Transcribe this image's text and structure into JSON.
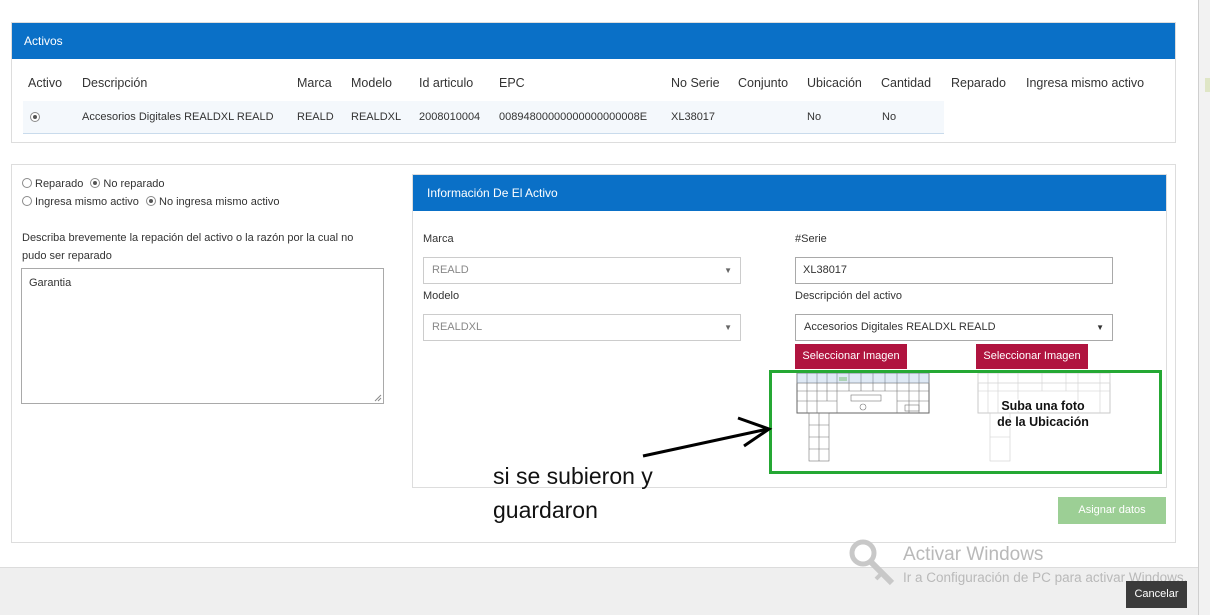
{
  "activos_panel": {
    "title": "Activos",
    "columns": [
      "Activo",
      "Descripción",
      "Marca",
      "Modelo",
      "Id articulo",
      "EPC",
      "No Serie",
      "Conjunto",
      "Ubicación",
      "Cantidad",
      "Reparado",
      "Ingresa mismo activo"
    ],
    "row": {
      "descripcion": "Accesorios Digitales REALDXL REALD",
      "marca": "REALD",
      "modelo": "REALDXL",
      "id_articulo": "2008010004",
      "epc": "00894800000000000000008E",
      "no_serie": "XL38017",
      "conjunto": "",
      "ubicacion": "No",
      "cantidad": "No"
    }
  },
  "repair_form": {
    "reparado_label": "Reparado",
    "no_reparado_label": "No reparado",
    "ingresa_label": "Ingresa mismo activo",
    "no_ingresa_label": "No ingresa mismo activo",
    "reason_label": "Describa brevemente la repación del activo o la razón por la cual no pudo ser reparado",
    "reason_value": "Garantia"
  },
  "info_panel": {
    "title": "Información De El Activo",
    "marca_label": "Marca",
    "marca_value": "REALD",
    "modelo_label": "Modelo",
    "modelo_value": "REALDXL",
    "serie_label": "#Serie",
    "serie_value": "XL38017",
    "descripcion_label": "Descripción del activo",
    "descripcion_value": "Accesorios Digitales REALDXL REALD",
    "select_image_label": "Seleccionar Imagen",
    "overlay_text_1": "Suba una foto",
    "overlay_text_2": "de la Ubicación"
  },
  "actions": {
    "assign_label": "Asignar datos",
    "cancel_label": "Cancelar"
  },
  "annotation": {
    "line1": "si se subieron y",
    "line2": "guardaron"
  },
  "watermark": {
    "line1": "Activar Windows",
    "line2": "Ir a Configuración de PC para activar Windows."
  },
  "colors": {
    "header_blue": "#0a70c7",
    "image_button": "#b0143f",
    "assign_button": "#9ccf95",
    "annotation_green": "#25a834"
  }
}
